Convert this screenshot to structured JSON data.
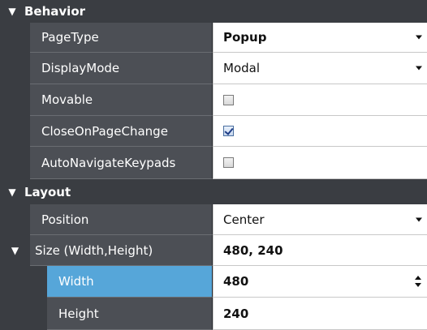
{
  "sections": {
    "behavior": {
      "title": "Behavior",
      "page_type": {
        "label": "PageType",
        "value": "Popup"
      },
      "display_mode": {
        "label": "DisplayMode",
        "value": "Modal"
      },
      "movable": {
        "label": "Movable",
        "checked": false
      },
      "close_on_page_change": {
        "label": "CloseOnPageChange",
        "checked": true
      },
      "auto_navigate_keypads": {
        "label": "AutoNavigateKeypads",
        "checked": false
      }
    },
    "layout": {
      "title": "Layout",
      "position": {
        "label": "Position",
        "value": "Center"
      },
      "size": {
        "label": "Size (Width,Height)",
        "value": "480, 240",
        "width": {
          "label": "Width",
          "value": "480"
        },
        "height": {
          "label": "Height",
          "value": "240"
        }
      }
    }
  },
  "icons": {
    "expand": "triangle-down-icon",
    "dropdown": "chevron-down-icon",
    "spinner": "spinner-arrows-icon"
  },
  "colors": {
    "section_bg": "#3a3d42",
    "name_bg": "#4c4f55",
    "selected_bg": "#56a6d9",
    "value_bg": "#ffffff"
  }
}
